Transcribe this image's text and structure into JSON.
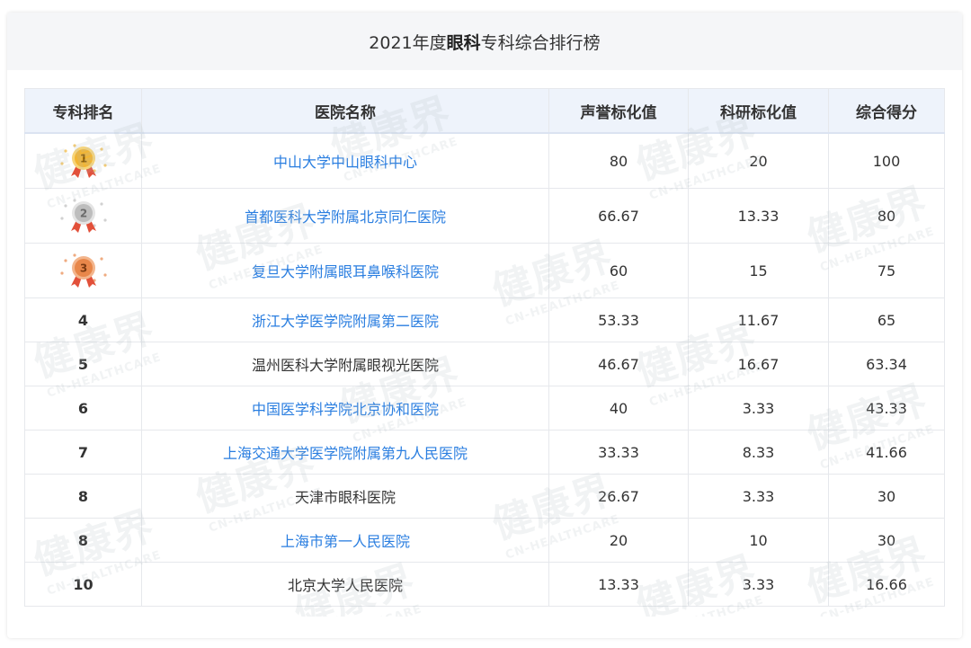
{
  "title": {
    "prefix": "2021年度",
    "highlight": "眼科",
    "suffix": "专科综合排行榜"
  },
  "columns": [
    "专科排名",
    "医院名称",
    "声誉标化值",
    "科研标化值",
    "综合得分"
  ],
  "rows": [
    {
      "rank": "1",
      "name": "中山大学中山眼科中心",
      "reputation": "80",
      "research": "20",
      "score": "100",
      "link": true,
      "medal": "gold"
    },
    {
      "rank": "2",
      "name": "首都医科大学附属北京同仁医院",
      "reputation": "66.67",
      "research": "13.33",
      "score": "80",
      "link": true,
      "medal": "silver"
    },
    {
      "rank": "3",
      "name": "复旦大学附属眼耳鼻喉科医院",
      "reputation": "60",
      "research": "15",
      "score": "75",
      "link": true,
      "medal": "bronze"
    },
    {
      "rank": "4",
      "name": "浙江大学医学院附属第二医院",
      "reputation": "53.33",
      "research": "11.67",
      "score": "65",
      "link": true
    },
    {
      "rank": "5",
      "name": "温州医科大学附属眼视光医院",
      "reputation": "46.67",
      "research": "16.67",
      "score": "63.34",
      "link": false
    },
    {
      "rank": "6",
      "name": "中国医学科学院北京协和医院",
      "reputation": "40",
      "research": "3.33",
      "score": "43.33",
      "link": true
    },
    {
      "rank": "7",
      "name": "上海交通大学医学院附属第九人民医院",
      "reputation": "33.33",
      "research": "8.33",
      "score": "41.66",
      "link": true
    },
    {
      "rank": "8",
      "name": "天津市眼科医院",
      "reputation": "26.67",
      "research": "3.33",
      "score": "30",
      "link": false
    },
    {
      "rank": "8",
      "name": "上海市第一人民医院",
      "reputation": "20",
      "research": "10",
      "score": "30",
      "link": true
    },
    {
      "rank": "10",
      "name": "北京大学人民医院",
      "reputation": "13.33",
      "research": "3.33",
      "score": "16.66",
      "link": false
    }
  ],
  "watermark": {
    "text": "健康界",
    "subtext": "CN-HEALTHCARE"
  },
  "colors": {
    "link": "#2a7ee0",
    "header_bg": "#eef3fb",
    "title_bg": "#f5f6f8",
    "gold": "#f2b533",
    "silver": "#bdbdbd",
    "bronze": "#e8874a",
    "ribbon": "#e2503a"
  }
}
